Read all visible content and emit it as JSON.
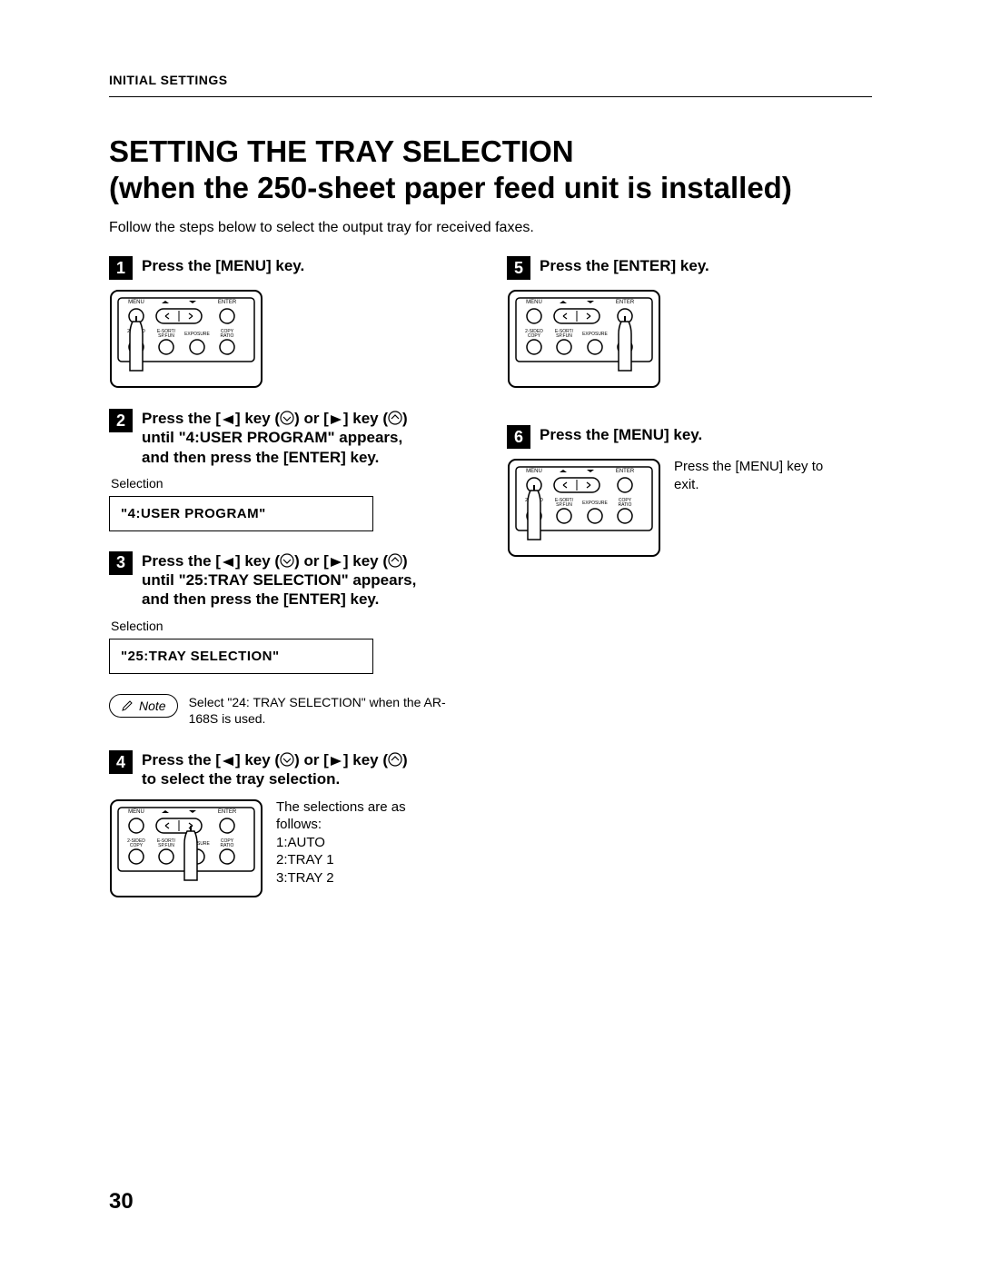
{
  "header": "INITIAL SETTINGS",
  "title_line1": "SETTING THE TRAY SELECTION",
  "title_line2": "(when the 250-sheet paper feed unit is installed)",
  "intro": "Follow the steps below to select the output tray for received faxes.",
  "panel": {
    "labels": {
      "menu": "MENU",
      "enter": "ENTER",
      "two_sided_copy_l1": "2-SIDED",
      "two_sided_copy_l2": "COPY",
      "esort_l1": "E-SORT/",
      "esort_l2": "SP.FUN",
      "exposure": "EXPOSURE",
      "copy_ratio_l1": "COPY",
      "copy_ratio_l2": "RATIO"
    }
  },
  "steps": {
    "s1": {
      "num": "1",
      "title": "Press the [MENU] key."
    },
    "s2": {
      "num": "2",
      "title_pre": "Press the [",
      "title_mid1": "] key (",
      "title_mid2": ") or [",
      "title_mid3": "] key (",
      "title_post": ")",
      "title_line2": "until \"4:USER PROGRAM\" appears,",
      "title_line3": "and then press the [ENTER] key.",
      "selection_label": "Selection",
      "lcd": "\"4:USER PROGRAM\""
    },
    "s3": {
      "num": "3",
      "title_pre": "Press the [",
      "title_mid1": "] key (",
      "title_mid2": ") or [",
      "title_mid3": "] key (",
      "title_post": ")",
      "title_line2": "until \"25:TRAY SELECTION\" appears,",
      "title_line3": "and then press the [ENTER] key.",
      "selection_label": "Selection",
      "lcd": "\"25:TRAY SELECTION\""
    },
    "note": {
      "label": "Note",
      "text": "Select \"24: TRAY SELECTION\" when the AR-168S is used."
    },
    "s4": {
      "num": "4",
      "title_pre": "Press the [",
      "title_mid1": "] key (",
      "title_mid2": ") or [",
      "title_mid3": "] key (",
      "title_post": ")",
      "title_line2": "to select the tray selection.",
      "side_l1": "The selections are as",
      "side_l2": "follows:",
      "side_l3": "1:AUTO",
      "side_l4": "2:TRAY 1",
      "side_l5": "3:TRAY 2"
    },
    "s5": {
      "num": "5",
      "title": "Press the [ENTER] key."
    },
    "s6": {
      "num": "6",
      "title": "Press the [MENU] key.",
      "side_l1": "Press the [MENU] key to",
      "side_l2": "exit."
    }
  },
  "page_number": "30"
}
